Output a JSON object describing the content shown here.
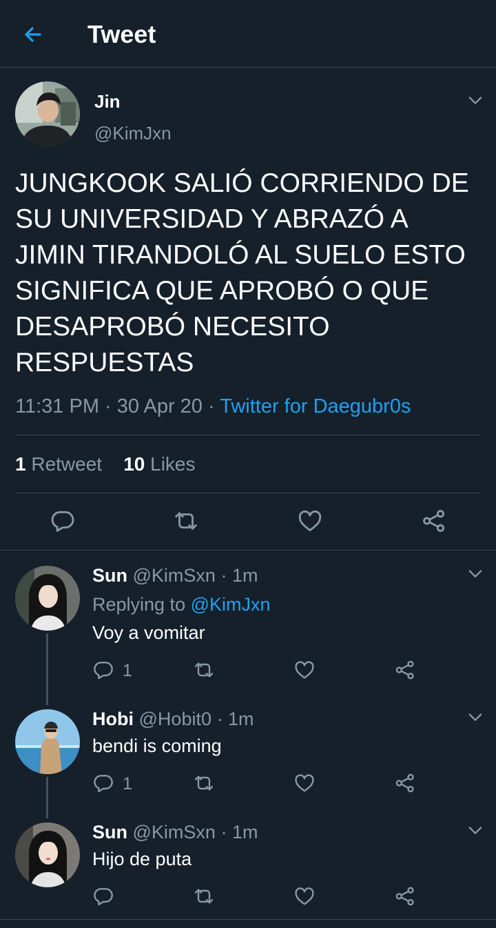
{
  "header": {
    "title": "Tweet"
  },
  "tweet": {
    "name": "Jin",
    "handle": "@KimJxn",
    "text": "JUNGKOOK SALIÓ CORRIENDO DE SU UNIVERSIDAD Y ABRAZÓ A JIMIN TIRANDOLÓ AL SUELO ESTO SIGNIFICA QUE APROBÓ O QUE DESAPROBÓ NECESITO RESPUESTAS",
    "time": "11:31 PM",
    "date": "30 Apr 20",
    "source": "Twitter for Daegubr0s",
    "retweets_count": "1",
    "retweets_label": "Retweet",
    "likes_count": "10",
    "likes_label": "Likes"
  },
  "replies": [
    {
      "name": "Sun",
      "handle": "@KimSxn",
      "time": "1m",
      "replying_label": "Replying to",
      "replying_to": "@KimJxn",
      "text": "Voy a vomitar",
      "reply_count": "1"
    },
    {
      "name": "Hobi",
      "handle": "@Hobit0",
      "time": "1m",
      "text": "bendi is coming",
      "reply_count": "1"
    },
    {
      "name": "Sun",
      "handle": "@KimSxn",
      "time": "1m",
      "text": "Hijo de puta",
      "reply_count": ""
    }
  ],
  "colors": {
    "background": "#15202b",
    "accent": "#1da1f2",
    "secondary_text": "#8899a6",
    "divider": "#38444d"
  },
  "icons": [
    "back-arrow-icon",
    "chevron-down-icon",
    "reply-icon",
    "retweet-icon",
    "like-icon",
    "share-icon"
  ]
}
